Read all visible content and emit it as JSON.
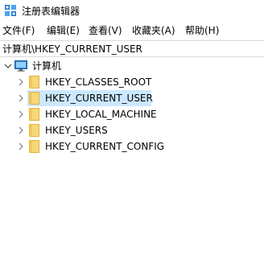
{
  "window": {
    "title": "注册表编辑器",
    "icon": "regedit-icon"
  },
  "menubar": {
    "items": [
      {
        "label": "文件(F)"
      },
      {
        "label": "编辑(E)"
      },
      {
        "label": "查看(V)"
      },
      {
        "label": "收藏夹(A)"
      },
      {
        "label": "帮助(H)"
      }
    ]
  },
  "address": {
    "path": "计算机\\HKEY_CURRENT_USER"
  },
  "tree": {
    "root": {
      "label": "计算机",
      "icon": "computer-icon",
      "expanded": true
    },
    "children": [
      {
        "label": "HKEY_CLASSES_ROOT",
        "selected": false
      },
      {
        "label": "HKEY_CURRENT_USER",
        "selected": true
      },
      {
        "label": "HKEY_LOCAL_MACHINE",
        "selected": false
      },
      {
        "label": "HKEY_USERS",
        "selected": false
      },
      {
        "label": "HKEY_CURRENT_CONFIG",
        "selected": false
      }
    ]
  },
  "colors": {
    "selection": "#cce8ff",
    "folder": "#f8d775",
    "folder_dark": "#e0b040",
    "chevron": "#808080"
  }
}
